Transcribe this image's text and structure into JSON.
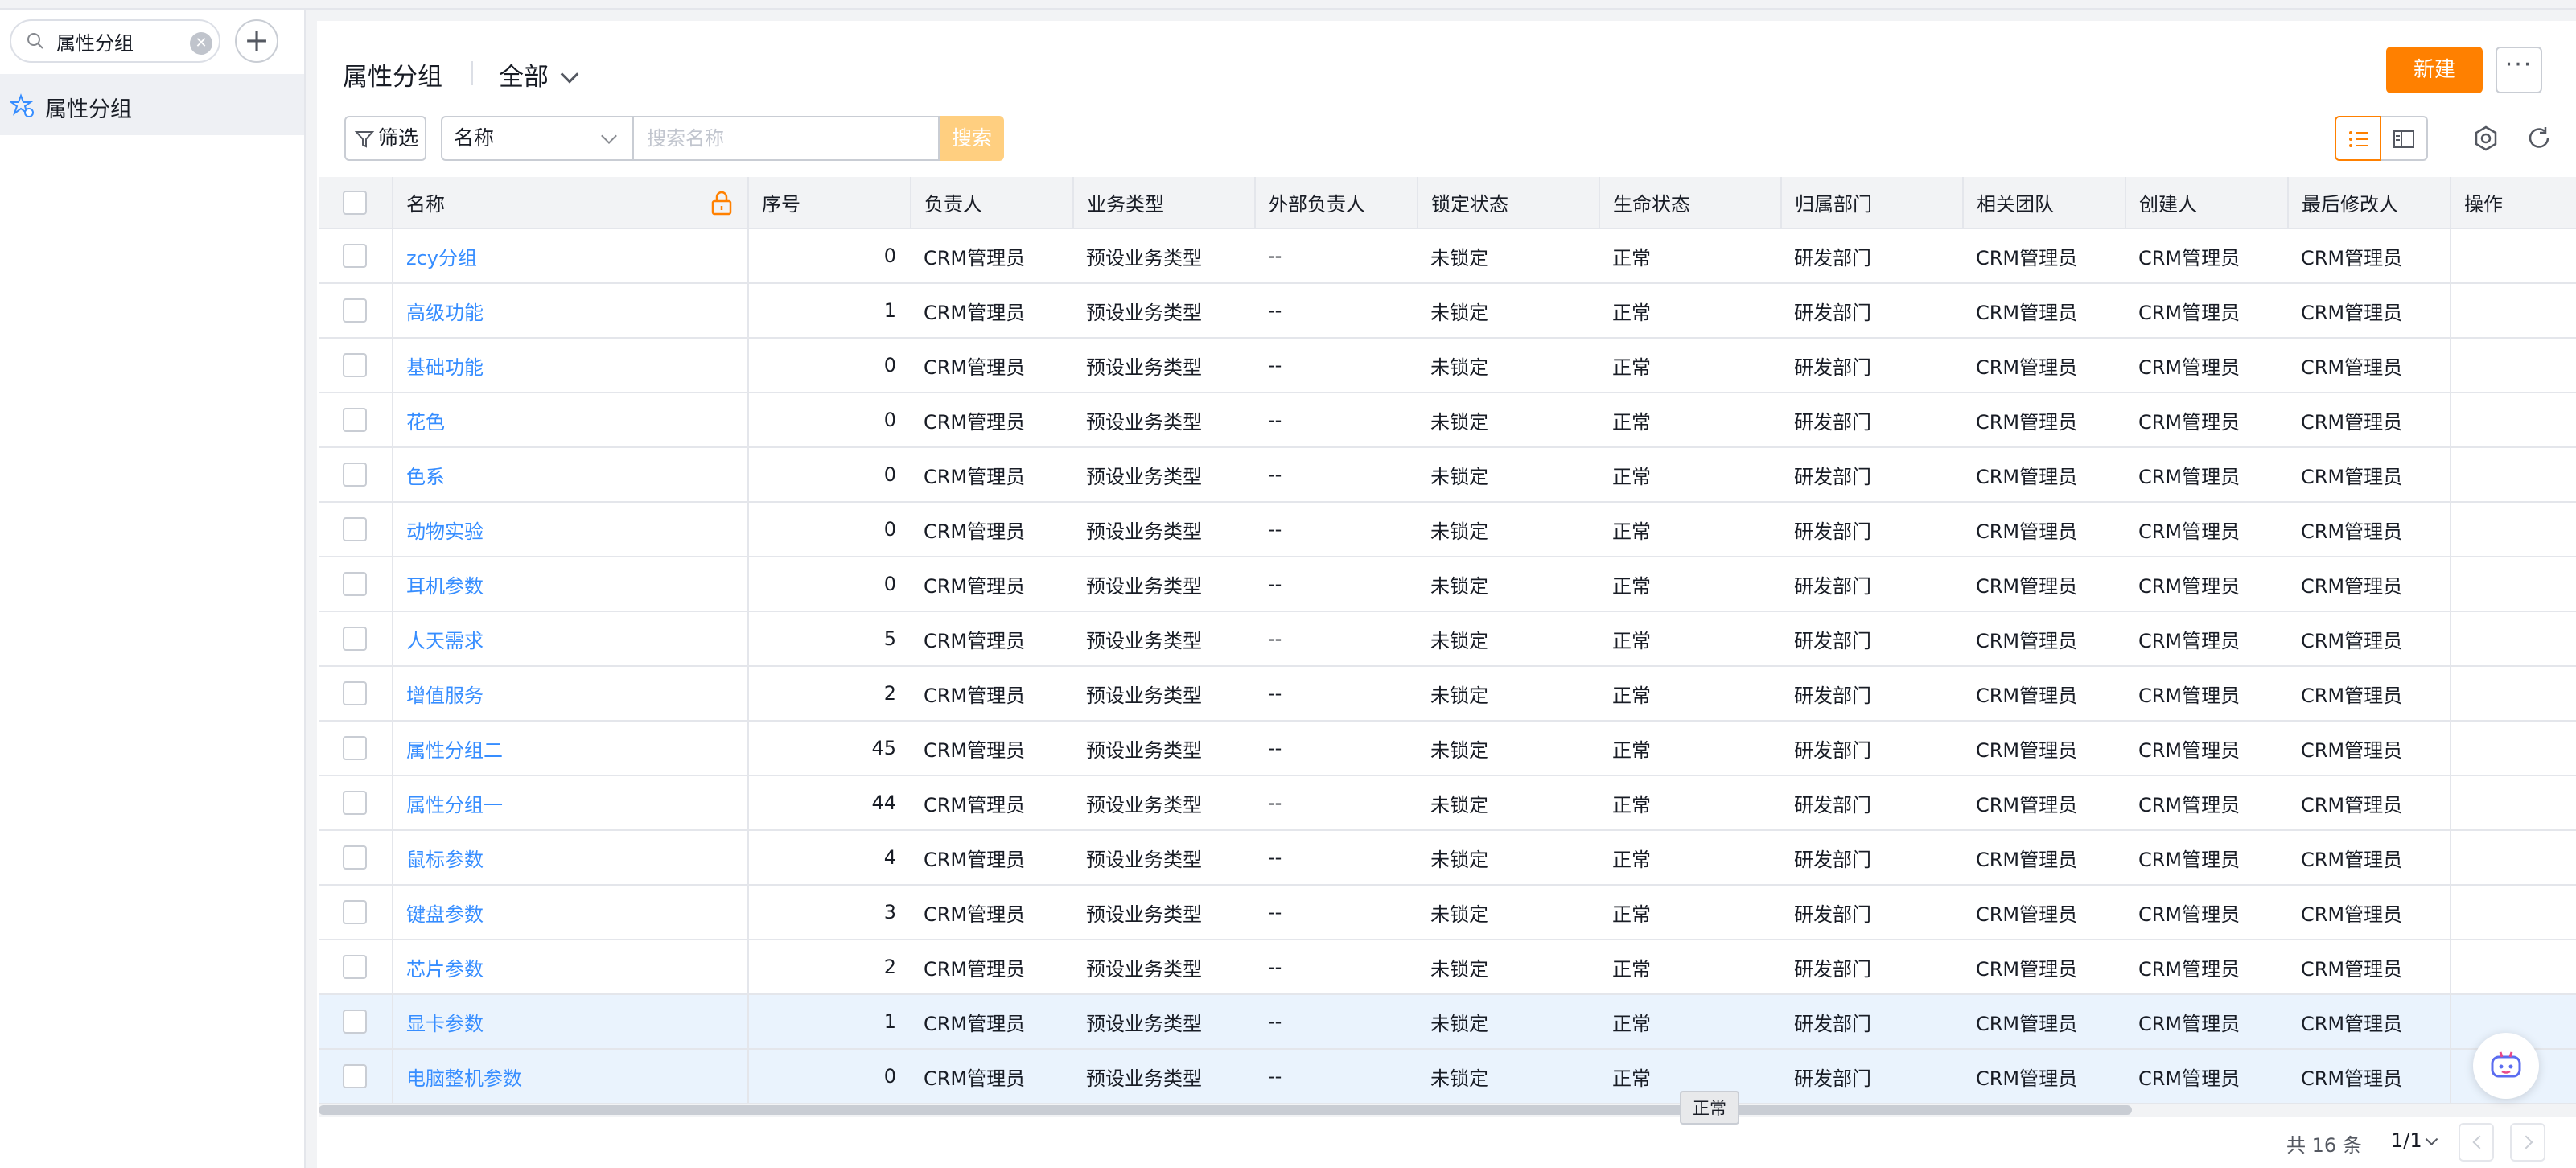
{
  "sidebar": {
    "search_value": "属性分组",
    "clear_icon": "clear-circle-icon",
    "add_icon": "plus-icon",
    "add_symbol": "+",
    "items": [
      {
        "label": "属性分组",
        "icon": "star-settings-icon"
      }
    ]
  },
  "header": {
    "title": "属性分组",
    "scope": "全部",
    "new_button": "新建",
    "more_button": "···"
  },
  "toolbar": {
    "filter_label": "筛选",
    "field_select": "名称",
    "search_placeholder": "搜索名称",
    "search_button": "搜索"
  },
  "table": {
    "columns": [
      "名称",
      "序号",
      "负责人",
      "业务类型",
      "外部负责人",
      "锁定状态",
      "生命状态",
      "归属部门",
      "相关团队",
      "创建人",
      "最后修改人",
      "操作"
    ],
    "rows": [
      {
        "name": "zcy分组",
        "seq": "0",
        "owner": "CRM管理员",
        "biz_type": "预设业务类型",
        "ext_owner": "--",
        "lock": "未锁定",
        "life": "正常",
        "dept": "研发部门",
        "team": "CRM管理员",
        "creator": "CRM管理员",
        "modifier": "CRM管理员"
      },
      {
        "name": "高级功能",
        "seq": "1",
        "owner": "CRM管理员",
        "biz_type": "预设业务类型",
        "ext_owner": "--",
        "lock": "未锁定",
        "life": "正常",
        "dept": "研发部门",
        "team": "CRM管理员",
        "creator": "CRM管理员",
        "modifier": "CRM管理员"
      },
      {
        "name": "基础功能",
        "seq": "0",
        "owner": "CRM管理员",
        "biz_type": "预设业务类型",
        "ext_owner": "--",
        "lock": "未锁定",
        "life": "正常",
        "dept": "研发部门",
        "team": "CRM管理员",
        "creator": "CRM管理员",
        "modifier": "CRM管理员"
      },
      {
        "name": "花色",
        "seq": "0",
        "owner": "CRM管理员",
        "biz_type": "预设业务类型",
        "ext_owner": "--",
        "lock": "未锁定",
        "life": "正常",
        "dept": "研发部门",
        "team": "CRM管理员",
        "creator": "CRM管理员",
        "modifier": "CRM管理员"
      },
      {
        "name": "色系",
        "seq": "0",
        "owner": "CRM管理员",
        "biz_type": "预设业务类型",
        "ext_owner": "--",
        "lock": "未锁定",
        "life": "正常",
        "dept": "研发部门",
        "team": "CRM管理员",
        "creator": "CRM管理员",
        "modifier": "CRM管理员"
      },
      {
        "name": "动物实验",
        "seq": "0",
        "owner": "CRM管理员",
        "biz_type": "预设业务类型",
        "ext_owner": "--",
        "lock": "未锁定",
        "life": "正常",
        "dept": "研发部门",
        "team": "CRM管理员",
        "creator": "CRM管理员",
        "modifier": "CRM管理员"
      },
      {
        "name": "耳机参数",
        "seq": "0",
        "owner": "CRM管理员",
        "biz_type": "预设业务类型",
        "ext_owner": "--",
        "lock": "未锁定",
        "life": "正常",
        "dept": "研发部门",
        "team": "CRM管理员",
        "creator": "CRM管理员",
        "modifier": "CRM管理员"
      },
      {
        "name": "人天需求",
        "seq": "5",
        "owner": "CRM管理员",
        "biz_type": "预设业务类型",
        "ext_owner": "--",
        "lock": "未锁定",
        "life": "正常",
        "dept": "研发部门",
        "team": "CRM管理员",
        "creator": "CRM管理员",
        "modifier": "CRM管理员"
      },
      {
        "name": "增值服务",
        "seq": "2",
        "owner": "CRM管理员",
        "biz_type": "预设业务类型",
        "ext_owner": "--",
        "lock": "未锁定",
        "life": "正常",
        "dept": "研发部门",
        "team": "CRM管理员",
        "creator": "CRM管理员",
        "modifier": "CRM管理员"
      },
      {
        "name": "属性分组二",
        "seq": "45",
        "owner": "CRM管理员",
        "biz_type": "预设业务类型",
        "ext_owner": "--",
        "lock": "未锁定",
        "life": "正常",
        "dept": "研发部门",
        "team": "CRM管理员",
        "creator": "CRM管理员",
        "modifier": "CRM管理员"
      },
      {
        "name": "属性分组一",
        "seq": "44",
        "owner": "CRM管理员",
        "biz_type": "预设业务类型",
        "ext_owner": "--",
        "lock": "未锁定",
        "life": "正常",
        "dept": "研发部门",
        "team": "CRM管理员",
        "creator": "CRM管理员",
        "modifier": "CRM管理员"
      },
      {
        "name": "鼠标参数",
        "seq": "4",
        "owner": "CRM管理员",
        "biz_type": "预设业务类型",
        "ext_owner": "--",
        "lock": "未锁定",
        "life": "正常",
        "dept": "研发部门",
        "team": "CRM管理员",
        "creator": "CRM管理员",
        "modifier": "CRM管理员"
      },
      {
        "name": "键盘参数",
        "seq": "3",
        "owner": "CRM管理员",
        "biz_type": "预设业务类型",
        "ext_owner": "--",
        "lock": "未锁定",
        "life": "正常",
        "dept": "研发部门",
        "team": "CRM管理员",
        "creator": "CRM管理员",
        "modifier": "CRM管理员"
      },
      {
        "name": "芯片参数",
        "seq": "2",
        "owner": "CRM管理员",
        "biz_type": "预设业务类型",
        "ext_owner": "--",
        "lock": "未锁定",
        "life": "正常",
        "dept": "研发部门",
        "team": "CRM管理员",
        "creator": "CRM管理员",
        "modifier": "CRM管理员"
      },
      {
        "name": "显卡参数",
        "seq": "1",
        "owner": "CRM管理员",
        "biz_type": "预设业务类型",
        "ext_owner": "--",
        "lock": "未锁定",
        "life": "正常",
        "dept": "研发部门",
        "team": "CRM管理员",
        "creator": "CRM管理员",
        "modifier": "CRM管理员",
        "highlight": true
      },
      {
        "name": "电脑整机参数",
        "seq": "0",
        "owner": "CRM管理员",
        "biz_type": "预设业务类型",
        "ext_owner": "--",
        "lock": "未锁定",
        "life": "正常",
        "dept": "研发部门",
        "team": "CRM管理员",
        "creator": "CRM管理员",
        "modifier": "CRM管理员",
        "highlight": true
      }
    ]
  },
  "tooltip": "正常",
  "footer": {
    "total": "共 16 条",
    "page": "1/1"
  },
  "colors": {
    "accent": "#ff8000",
    "link": "#368dff",
    "row_highlight": "#eaf3fd"
  }
}
